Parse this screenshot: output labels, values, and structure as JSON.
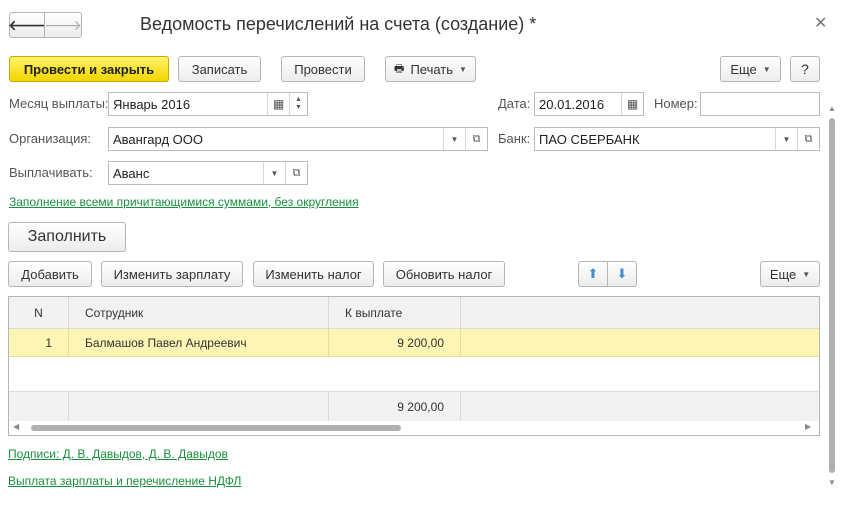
{
  "window": {
    "title": "Ведомость перечислений на счета (создание) *"
  },
  "nav": {
    "back_glyph": "🡐",
    "forward_glyph": "🡒"
  },
  "toolbar": {
    "post_close": "Провести и закрыть",
    "save": "Записать",
    "post": "Провести",
    "print": "Печать",
    "more": "Еще",
    "help": "?"
  },
  "form": {
    "month_label": "Месяц выплаты:",
    "month_value": "Январь 2016",
    "date_label": "Дата:",
    "date_value": "20.01.2016",
    "number_label": "Номер:",
    "number_value": "",
    "org_label": "Организация:",
    "org_value": "Авангард ООО",
    "bank_label": "Банк:",
    "bank_value": "ПАО СБЕРБАНК",
    "pay_label": "Выплачивать:",
    "pay_value": "Аванс"
  },
  "fill_mode_link": "Заполнение всеми причитающимися суммами, без округления",
  "fill_button": "Заполнить",
  "table_toolbar": {
    "add": "Добавить",
    "change_salary": "Изменить зарплату",
    "change_tax": "Изменить налог",
    "update_tax": "Обновить налог",
    "more": "Еще"
  },
  "table": {
    "columns": [
      "N",
      "Сотрудник",
      "К выплате"
    ],
    "rows": [
      {
        "n": "1",
        "employee": "Балмашов Павел Андреевич",
        "amount": "9 200,00"
      }
    ],
    "total": "9 200,00"
  },
  "footer": {
    "signatures": "Подписи: Д. В. Давыдов, Д. В. Давыдов",
    "payment": "Выплата зарплаты и перечисление НДФЛ"
  },
  "colors": {
    "accent": "#f2d500",
    "selected_row": "#fdf5b3",
    "link": "#1a8f3c"
  }
}
